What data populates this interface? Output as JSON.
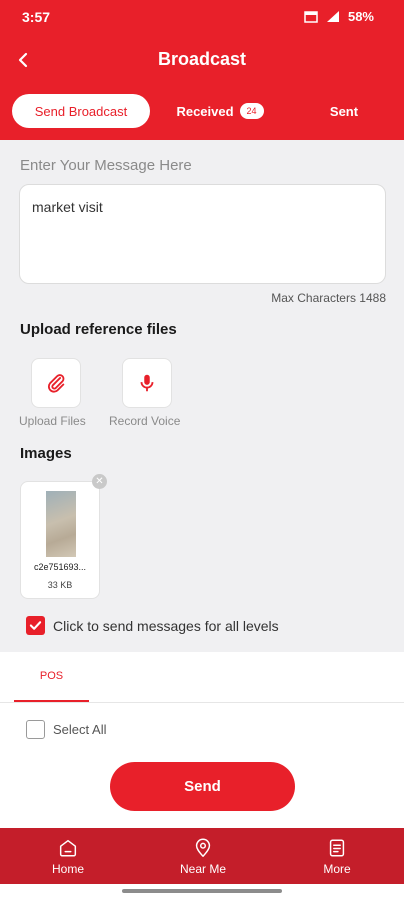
{
  "status_bar": {
    "time": "3:57",
    "battery": "58%"
  },
  "header": {
    "title": "Broadcast"
  },
  "tabs": [
    {
      "label": "Send Broadcast"
    },
    {
      "label": "Received",
      "badge": "24"
    },
    {
      "label": "Sent"
    }
  ],
  "message": {
    "label": "Enter Your Message Here",
    "value": "market visit",
    "max_chars_text": "Max Characters 1488"
  },
  "upload": {
    "title": "Upload reference files",
    "upload_files_label": "Upload Files",
    "record_voice_label": "Record Voice"
  },
  "images": {
    "title": "Images",
    "items": [
      {
        "name": "c2e751693...",
        "size": "33 KB"
      }
    ]
  },
  "all_levels": {
    "label": "Click to send messages for all levels",
    "checked": true
  },
  "levels": {
    "tab": "POS",
    "select_all_label": "Select All"
  },
  "send_label": "Send",
  "bottom_nav": [
    {
      "label": "Home",
      "icon": "home-icon"
    },
    {
      "label": "Near Me",
      "icon": "location-pin-icon"
    },
    {
      "label": "More",
      "icon": "more-icon"
    }
  ],
  "colors": {
    "accent": "#e8202a",
    "nav_bg": "#c41e2a"
  }
}
